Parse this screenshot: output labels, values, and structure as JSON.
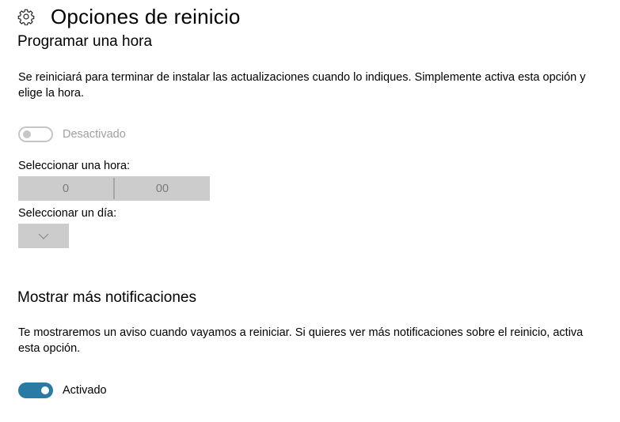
{
  "header": {
    "title": "Opciones de reinicio",
    "icon": "gear-icon"
  },
  "schedule": {
    "title": "Programar una hora",
    "description": "Se reiniciará para terminar de instalar las actualizaciones cuando lo indiques. Simplemente activa esta opción y elige la hora.",
    "toggle_state": "off",
    "toggle_label": "Desactivado",
    "time_label": "Seleccionar una hora:",
    "hour": "0",
    "minute": "00",
    "day_label": "Seleccionar un día:"
  },
  "notifications": {
    "title": "Mostrar más notificaciones",
    "description": "Te mostraremos un aviso cuando vayamos a reiniciar. Si quieres ver más notificaciones sobre el reinicio, activa esta opción.",
    "toggle_state": "on",
    "toggle_label": "Activado"
  },
  "colors": {
    "accent": "#2a7ba3",
    "disabled": "#cccccc"
  }
}
